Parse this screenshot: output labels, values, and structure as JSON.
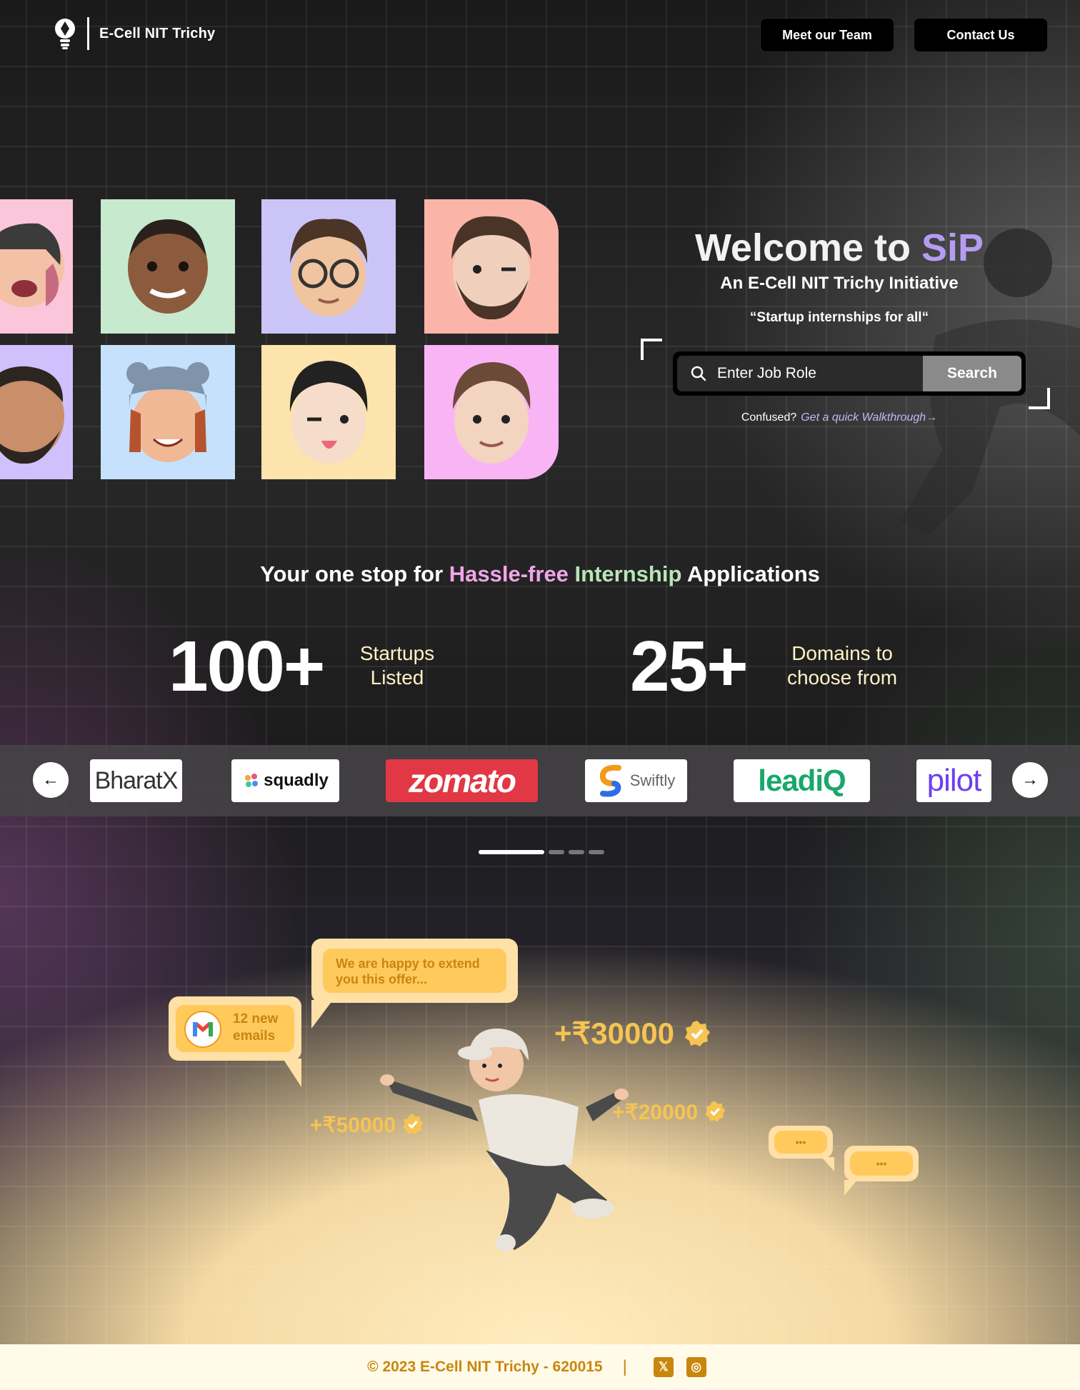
{
  "header": {
    "brand": "E-Cell NIT Trichy",
    "meet_team": "Meet our Team",
    "contact": "Contact Us"
  },
  "hero": {
    "welcome_prefix": "Welcome to ",
    "welcome_accent": "SiP",
    "initiative": "An E-Cell NIT Trichy Initiative",
    "quote": "“Startup internships for all“",
    "search_placeholder": "Enter Job Role",
    "search_button": "Search",
    "confused": "Confused?",
    "walkthrough": "Get a quick Walkthrough→"
  },
  "tagline": {
    "part1": "Your one stop for ",
    "pink": "Hassle-free ",
    "green": "Internship",
    "part2": " Applications"
  },
  "stats": [
    {
      "number": "100+",
      "label_line1": "Startups",
      "label_line2": "Listed"
    },
    {
      "number": "25+",
      "label_line1": "Domains to",
      "label_line2": "choose from"
    }
  ],
  "partners": [
    "BharatX",
    "squadly",
    "zomato",
    "Swiftly",
    "leadiQ",
    "pilot"
  ],
  "illustration": {
    "offer_text": "We are happy to extend you this offer...",
    "emails_text": "12 new emails",
    "amount_1": "+₹30000",
    "amount_2": "+₹20000",
    "amount_3": "+₹50000",
    "typing": "•••"
  },
  "footer": {
    "copyright": "© 2023 E-Cell NIT Trichy - 620015",
    "separator": "|",
    "x_glyph": "𝕏",
    "insta_glyph": "◎"
  },
  "colors": {
    "accent_purple": "#b59cf2",
    "pink": "#f0a6e8",
    "green": "#b7e6b7",
    "gold": "#c8860f",
    "zomato_red": "#e23744"
  }
}
